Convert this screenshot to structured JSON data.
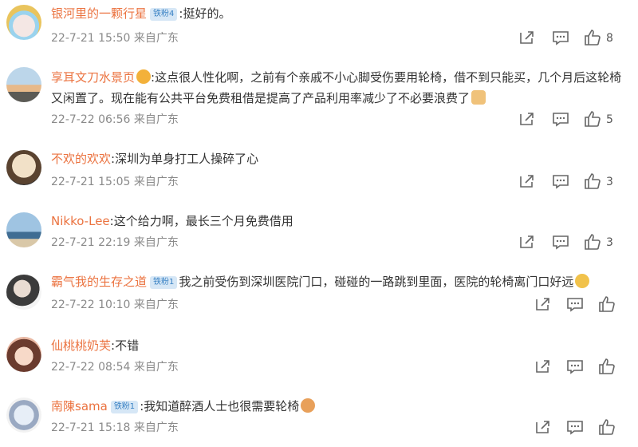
{
  "comments": [
    {
      "user": "银河里的一颗行星",
      "badge": "铁粉4",
      "text": "挺好的。",
      "time": "22-7-21 15:50 来自广东",
      "likes": "8"
    },
    {
      "user": "享耳文刀水景页",
      "badge": "",
      "text": "这点很人性化啊，之前有个亲戚不小心脚受伤要用轮椅，借不到只能买，几个月后这轮椅又闲置了。现在能有公共平台免费租借是提高了产品利用率减少了不必要浪费了",
      "time": "22-7-22 06:56 来自广东",
      "likes": "5"
    },
    {
      "user": "不欢的欢欢",
      "badge": "",
      "text": "深圳为单身打工人操碎了心",
      "time": "22-7-21 15:05 来自广东",
      "likes": "3"
    },
    {
      "user": "Nikko-Lee",
      "badge": "",
      "text": "这个给力啊，最长三个月免费借用",
      "time": "22-7-21 22:19 来自广东",
      "likes": "3"
    },
    {
      "user": "霸气我的生存之道",
      "badge": "铁粉1",
      "text": "我之前受伤到深圳医院门口，碰碰的一路跳到里面，医院的轮椅离门口好远",
      "time": "22-7-22 10:10 来自广东",
      "likes": ""
    },
    {
      "user": "仙桃桃奶芙",
      "badge": "",
      "text": "不错",
      "time": "22-7-22 08:54 来自广东",
      "likes": ""
    },
    {
      "user": "南陳sama",
      "badge": "铁粉1",
      "text": "我知道醉酒人士也很需要轮椅",
      "time": "22-7-21 15:18 来自广东",
      "likes": ""
    }
  ],
  "icons": {
    "share": "share-icon",
    "reply": "comment-icon",
    "like": "thumbs-up-icon"
  },
  "colors": {
    "username": "#eb7340",
    "badge_bg": "#d6e7f6",
    "badge_text": "#3a82c4",
    "meta": "#8a8a8a"
  }
}
